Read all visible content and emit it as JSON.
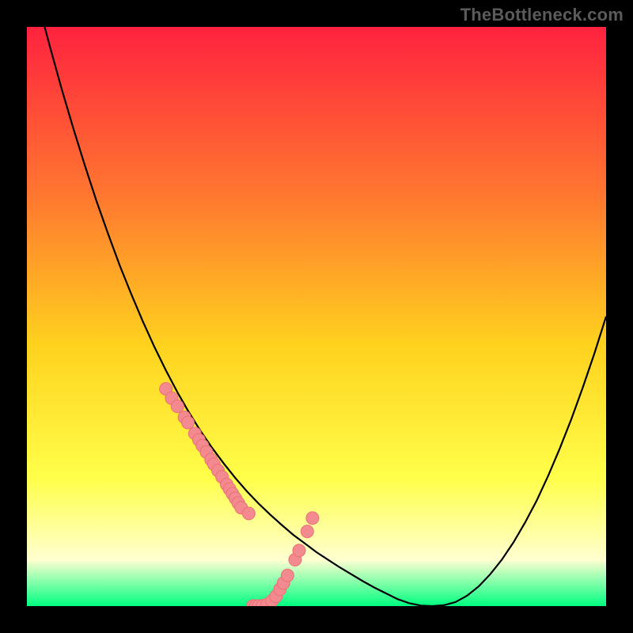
{
  "attribution": "TheBottleneck.com",
  "colors": {
    "background": "#000000",
    "gradient_top": "#ff223f",
    "gradient_mid1": "#ff7a2f",
    "gradient_mid2": "#ffd21e",
    "gradient_mid3": "#ffff4a",
    "gradient_pale": "#ffffd0",
    "gradient_bottom": "#00ff80",
    "curve": "#000000",
    "marker_fill": "#f28a8f",
    "marker_stroke": "#e97176"
  },
  "chart_data": {
    "type": "line",
    "title": "",
    "xlabel": "",
    "ylabel": "",
    "xlim": [
      0,
      100
    ],
    "ylim": [
      0,
      100
    ],
    "series": [
      {
        "name": "bottleneck-curve",
        "x": [
          0,
          2,
          4,
          6,
          8,
          10,
          12,
          14,
          16,
          18,
          20,
          22,
          24,
          26,
          28,
          30,
          32,
          34,
          36,
          38,
          40,
          42,
          44,
          46,
          48,
          50,
          52,
          54,
          56,
          58,
          60,
          62,
          64,
          66,
          68,
          70,
          72,
          74,
          76,
          78,
          80,
          82,
          84,
          86,
          88,
          90,
          92,
          94,
          96,
          98,
          100
        ],
        "y": [
          112,
          104,
          96.5,
          89.3,
          82.5,
          76.1,
          70,
          64.3,
          58.9,
          53.9,
          49.2,
          44.8,
          40.7,
          36.9,
          33.4,
          30.2,
          27.3,
          24.6,
          22.1,
          19.8,
          17.7,
          15.8,
          14,
          12.3,
          10.8,
          9.3,
          8,
          6.7,
          5.5,
          4.3,
          3.2,
          2.2,
          1.2,
          0.5,
          0.1,
          0,
          0.15,
          0.7,
          1.8,
          3.4,
          5.5,
          8,
          11,
          14.4,
          18.2,
          22.5,
          27.2,
          32.3,
          37.8,
          43.7,
          50
        ]
      }
    ],
    "markers": {
      "name": "sample-points",
      "x": [
        24,
        25,
        26,
        27.2,
        27.8,
        29,
        29.7,
        30.3,
        31,
        31.8,
        32.3,
        33,
        33.7,
        34.5,
        35,
        35.5,
        36,
        36.5,
        37,
        38.3,
        39,
        39.5,
        40,
        40.7,
        41.5,
        42.3,
        43,
        43.7,
        44.3,
        45,
        46.3,
        47,
        48.4,
        49.3
      ],
      "y": [
        37.5,
        35.9,
        34.5,
        32.6,
        31.7,
        29.8,
        28.7,
        27.7,
        26.6,
        25.3,
        24.5,
        23.4,
        22.3,
        21,
        20.2,
        19.4,
        18.6,
        17.8,
        17,
        16,
        0.02,
        0.02,
        0.02,
        0.05,
        0.3,
        0.9,
        1.7,
        2.9,
        4,
        5.3,
        8,
        9.6,
        12.9,
        15.2
      ]
    }
  }
}
